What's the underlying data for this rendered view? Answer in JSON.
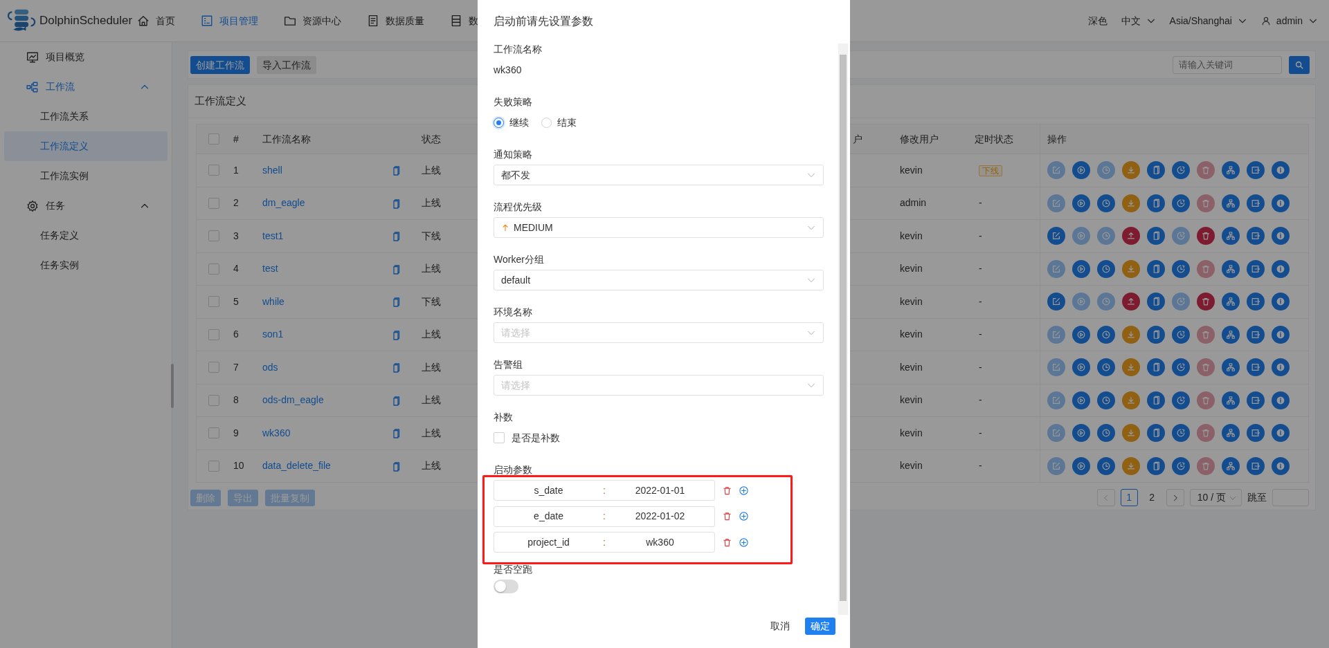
{
  "header": {
    "brand": "DolphinScheduler",
    "nav": [
      {
        "label": "首页",
        "kind": "home",
        "selected": false
      },
      {
        "label": "项目管理",
        "kind": "project",
        "selected": true
      },
      {
        "label": "资源中心",
        "kind": "resource",
        "selected": false
      },
      {
        "label": "数据质量",
        "kind": "quality",
        "selected": false
      },
      {
        "label": "数",
        "kind": "datasource",
        "selected": false
      }
    ],
    "theme": "深色",
    "language": "中文",
    "timezone": "Asia/Shanghai",
    "user": "admin"
  },
  "sidebar": {
    "items": [
      {
        "label": "项目概览",
        "kind": "overview",
        "selected": false
      },
      {
        "label": "工作流",
        "kind": "workflow",
        "expanded": true,
        "children": [
          {
            "label": "工作流关系",
            "selected": false
          },
          {
            "label": "工作流定义",
            "selected": true
          },
          {
            "label": "工作流实例",
            "selected": false
          }
        ]
      },
      {
        "label": "任务",
        "kind": "task",
        "expanded": true,
        "children": [
          {
            "label": "任务定义",
            "selected": false
          },
          {
            "label": "任务实例",
            "selected": false
          }
        ]
      }
    ]
  },
  "toolbar": {
    "buttons": [
      {
        "label": "创建工作流",
        "kind": "primary"
      },
      {
        "label": "导入工作流",
        "kind": "secondary"
      }
    ],
    "search": {
      "placeholder": "请输入关键词"
    }
  },
  "table": {
    "title": "工作流定义",
    "select_all": {
      "checked": false
    },
    "columns": [
      {
        "label": "#"
      },
      {
        "label": "工作流名称"
      },
      {
        "label": "状态"
      },
      {
        "label": "户"
      },
      {
        "label": "修改用户"
      },
      {
        "label": "定时状态"
      },
      {
        "label": "操作"
      }
    ],
    "rows": [
      {
        "checked": false,
        "index": "1",
        "name": "shell",
        "status": "上线",
        "modifier": "kevin",
        "schedule": {
          "kind": "tag",
          "text": "下线"
        },
        "actions": [
          {
            "kind": "edit",
            "disabled": true
          },
          {
            "kind": "run",
            "disabled": false
          },
          {
            "kind": "timing",
            "disabled": true
          },
          {
            "kind": "offline",
            "disabled": false
          },
          {
            "kind": "copy",
            "disabled": false
          },
          {
            "kind": "cron",
            "disabled": false
          },
          {
            "kind": "delete",
            "disabled": true
          },
          {
            "kind": "tree",
            "disabled": false
          },
          {
            "kind": "export",
            "disabled": false
          },
          {
            "kind": "info",
            "disabled": false
          }
        ]
      },
      {
        "checked": false,
        "index": "2",
        "name": "dm_eagle",
        "status": "上线",
        "modifier": "admin",
        "schedule": {
          "kind": "plain",
          "text": "-"
        },
        "actions": [
          {
            "kind": "edit",
            "disabled": true
          },
          {
            "kind": "run",
            "disabled": false
          },
          {
            "kind": "timing",
            "disabled": false
          },
          {
            "kind": "offline",
            "disabled": false
          },
          {
            "kind": "copy",
            "disabled": false
          },
          {
            "kind": "cron",
            "disabled": false
          },
          {
            "kind": "delete",
            "disabled": true
          },
          {
            "kind": "tree",
            "disabled": false
          },
          {
            "kind": "export",
            "disabled": false
          },
          {
            "kind": "info",
            "disabled": false
          }
        ]
      },
      {
        "checked": false,
        "index": "3",
        "name": "test1",
        "status": "下线",
        "modifier": "kevin",
        "schedule": {
          "kind": "plain",
          "text": "-"
        },
        "actions": [
          {
            "kind": "edit",
            "disabled": false
          },
          {
            "kind": "run",
            "disabled": true
          },
          {
            "kind": "timing",
            "disabled": true
          },
          {
            "kind": "online",
            "disabled": false
          },
          {
            "kind": "copy",
            "disabled": false
          },
          {
            "kind": "cron",
            "disabled": true
          },
          {
            "kind": "delete",
            "disabled": false
          },
          {
            "kind": "tree",
            "disabled": false
          },
          {
            "kind": "export",
            "disabled": false
          },
          {
            "kind": "info",
            "disabled": false
          }
        ]
      },
      {
        "checked": false,
        "index": "4",
        "name": "test",
        "status": "上线",
        "modifier": "kevin",
        "schedule": {
          "kind": "plain",
          "text": "-"
        },
        "actions": [
          {
            "kind": "edit",
            "disabled": true
          },
          {
            "kind": "run",
            "disabled": false
          },
          {
            "kind": "timing",
            "disabled": false
          },
          {
            "kind": "offline",
            "disabled": false
          },
          {
            "kind": "copy",
            "disabled": false
          },
          {
            "kind": "cron",
            "disabled": false
          },
          {
            "kind": "delete",
            "disabled": true
          },
          {
            "kind": "tree",
            "disabled": false
          },
          {
            "kind": "export",
            "disabled": false
          },
          {
            "kind": "info",
            "disabled": false
          }
        ]
      },
      {
        "checked": false,
        "index": "5",
        "name": "while",
        "status": "下线",
        "modifier": "kevin",
        "schedule": {
          "kind": "plain",
          "text": "-"
        },
        "actions": [
          {
            "kind": "edit",
            "disabled": false
          },
          {
            "kind": "run",
            "disabled": true
          },
          {
            "kind": "timing",
            "disabled": true
          },
          {
            "kind": "online",
            "disabled": false
          },
          {
            "kind": "copy",
            "disabled": false
          },
          {
            "kind": "cron",
            "disabled": true
          },
          {
            "kind": "delete",
            "disabled": false
          },
          {
            "kind": "tree",
            "disabled": false
          },
          {
            "kind": "export",
            "disabled": false
          },
          {
            "kind": "info",
            "disabled": false
          }
        ]
      },
      {
        "checked": false,
        "index": "6",
        "name": "son1",
        "status": "上线",
        "modifier": "kevin",
        "schedule": {
          "kind": "plain",
          "text": "-"
        },
        "actions": [
          {
            "kind": "edit",
            "disabled": true
          },
          {
            "kind": "run",
            "disabled": false
          },
          {
            "kind": "timing",
            "disabled": false
          },
          {
            "kind": "offline",
            "disabled": false
          },
          {
            "kind": "copy",
            "disabled": false
          },
          {
            "kind": "cron",
            "disabled": false
          },
          {
            "kind": "delete",
            "disabled": true
          },
          {
            "kind": "tree",
            "disabled": false
          },
          {
            "kind": "export",
            "disabled": false
          },
          {
            "kind": "info",
            "disabled": false
          }
        ]
      },
      {
        "checked": false,
        "index": "7",
        "name": "ods",
        "status": "上线",
        "modifier": "kevin",
        "schedule": {
          "kind": "plain",
          "text": "-"
        },
        "actions": [
          {
            "kind": "edit",
            "disabled": true
          },
          {
            "kind": "run",
            "disabled": false
          },
          {
            "kind": "timing",
            "disabled": false
          },
          {
            "kind": "offline",
            "disabled": false
          },
          {
            "kind": "copy",
            "disabled": false
          },
          {
            "kind": "cron",
            "disabled": false
          },
          {
            "kind": "delete",
            "disabled": true
          },
          {
            "kind": "tree",
            "disabled": false
          },
          {
            "kind": "export",
            "disabled": false
          },
          {
            "kind": "info",
            "disabled": false
          }
        ]
      },
      {
        "checked": false,
        "index": "8",
        "name": "ods-dm_eagle",
        "status": "上线",
        "modifier": "kevin",
        "schedule": {
          "kind": "plain",
          "text": "-"
        },
        "actions": [
          {
            "kind": "edit",
            "disabled": true
          },
          {
            "kind": "run",
            "disabled": false
          },
          {
            "kind": "timing",
            "disabled": false
          },
          {
            "kind": "offline",
            "disabled": false
          },
          {
            "kind": "copy",
            "disabled": false
          },
          {
            "kind": "cron",
            "disabled": false
          },
          {
            "kind": "delete",
            "disabled": true
          },
          {
            "kind": "tree",
            "disabled": false
          },
          {
            "kind": "export",
            "disabled": false
          },
          {
            "kind": "info",
            "disabled": false
          }
        ]
      },
      {
        "checked": false,
        "index": "9",
        "name": "wk360",
        "status": "上线",
        "modifier": "kevin",
        "schedule": {
          "kind": "plain",
          "text": "-"
        },
        "actions": [
          {
            "kind": "edit",
            "disabled": true
          },
          {
            "kind": "run",
            "disabled": false
          },
          {
            "kind": "timing",
            "disabled": false
          },
          {
            "kind": "offline",
            "disabled": false
          },
          {
            "kind": "copy",
            "disabled": false
          },
          {
            "kind": "cron",
            "disabled": false
          },
          {
            "kind": "delete",
            "disabled": true
          },
          {
            "kind": "tree",
            "disabled": false
          },
          {
            "kind": "export",
            "disabled": false
          },
          {
            "kind": "info",
            "disabled": false
          }
        ]
      },
      {
        "checked": false,
        "index": "10",
        "name": "data_delete_file",
        "status": "上线",
        "modifier": "kevin",
        "schedule": {
          "kind": "plain",
          "text": "-"
        },
        "actions": [
          {
            "kind": "edit",
            "disabled": true
          },
          {
            "kind": "run",
            "disabled": false
          },
          {
            "kind": "timing",
            "disabled": false
          },
          {
            "kind": "offline",
            "disabled": false
          },
          {
            "kind": "copy",
            "disabled": false
          },
          {
            "kind": "cron",
            "disabled": false
          },
          {
            "kind": "delete",
            "disabled": true
          },
          {
            "kind": "tree",
            "disabled": false
          },
          {
            "kind": "export",
            "disabled": false
          },
          {
            "kind": "info",
            "disabled": false
          }
        ]
      }
    ],
    "bulk_actions": [
      {
        "label": "删除",
        "disabled": true
      },
      {
        "label": "导出",
        "disabled": true
      },
      {
        "label": "批量复制",
        "disabled": true
      }
    ],
    "pagination": {
      "prev": {
        "disabled": true
      },
      "pages": [
        {
          "label": "1",
          "selected": true
        },
        {
          "label": "2",
          "selected": false
        }
      ],
      "next": {
        "disabled": false
      },
      "page_size": "10 / 页",
      "jump_label": "跳至"
    }
  },
  "dialog": {
    "title": "启动前请先设置参数",
    "fields": [
      {
        "kind": "text",
        "label": "工作流名称",
        "value": "wk360"
      },
      {
        "kind": "radio",
        "label": "失败策略",
        "options": [
          {
            "label": "继续",
            "selected": true
          },
          {
            "label": "结束",
            "selected": false
          }
        ]
      },
      {
        "kind": "select",
        "label": "通知策略",
        "value": "都不发"
      },
      {
        "kind": "priority",
        "label": "流程优先级",
        "value": "MEDIUM"
      },
      {
        "kind": "select",
        "label": "Worker分组",
        "value": "default"
      },
      {
        "kind": "select",
        "label": "环境名称",
        "placeholder": "请选择"
      },
      {
        "kind": "select",
        "label": "告警组",
        "placeholder": "请选择"
      },
      {
        "kind": "checkbox",
        "label": "补数",
        "option": "是否是补数",
        "checked": false
      },
      {
        "kind": "params",
        "label": "启动参数",
        "params": [
          {
            "key": "s_date",
            "separator": ":",
            "value": "2022-01-01"
          },
          {
            "key": "e_date",
            "separator": ":",
            "value": "2022-01-02"
          },
          {
            "key": "project_id",
            "separator": ":",
            "value": "wk360"
          }
        ]
      },
      {
        "kind": "switch",
        "label": "是否空跑",
        "on": false
      }
    ],
    "buttons": [
      {
        "label": "取消",
        "kind": "text"
      },
      {
        "label": "确定",
        "kind": "primary"
      }
    ]
  }
}
